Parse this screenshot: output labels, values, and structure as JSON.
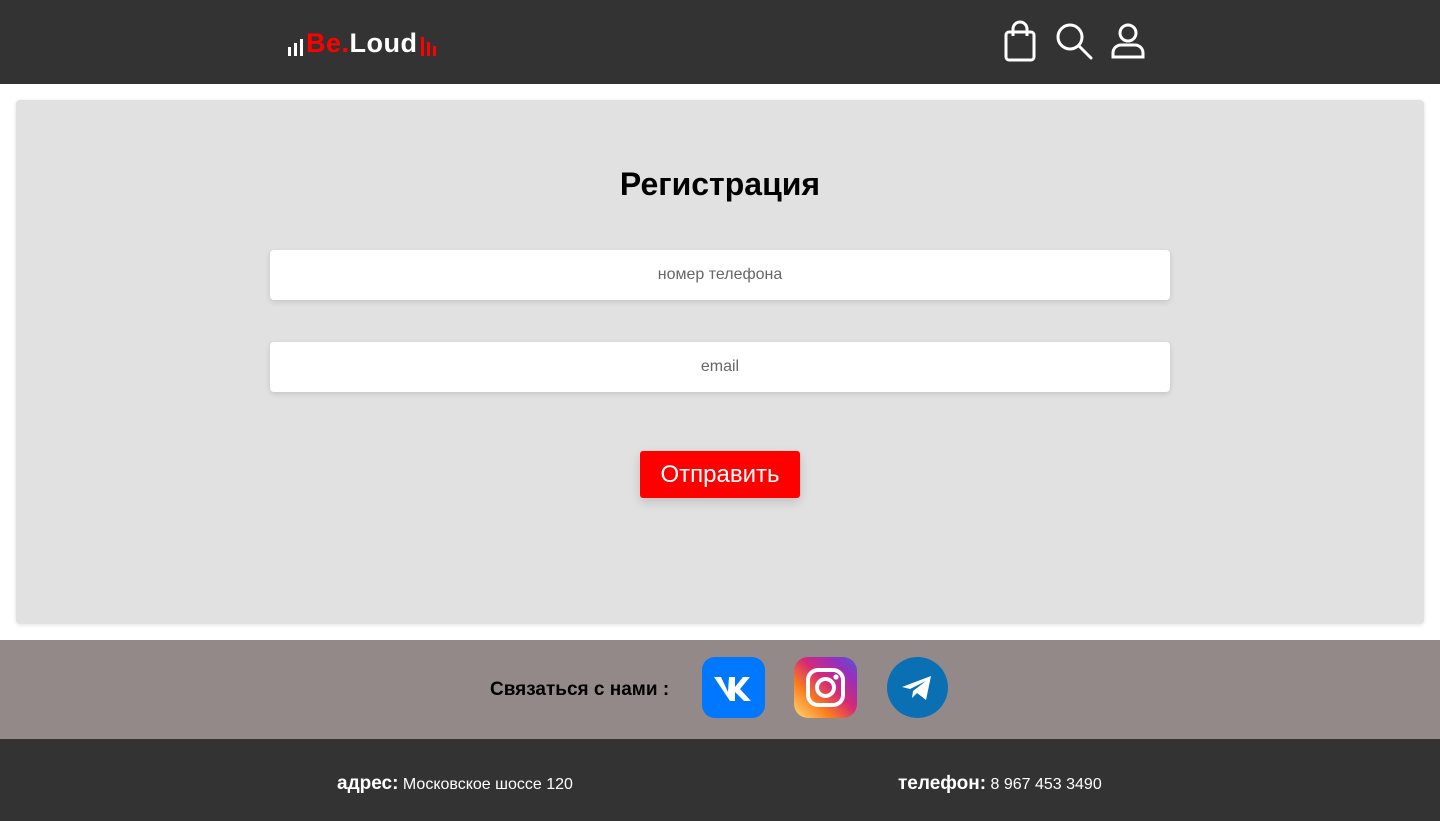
{
  "header": {
    "logo": {
      "part1": "Be.",
      "part2": "Loud"
    },
    "icons": [
      "cart-icon",
      "search-icon",
      "user-icon"
    ]
  },
  "form": {
    "title": "Регистрация",
    "phone_placeholder": "номер телефона",
    "email_placeholder": "email",
    "submit_label": "Отправить"
  },
  "contact": {
    "label": "Связаться с нами :",
    "socials": [
      {
        "name": "vk-icon",
        "color": "#0077ff"
      },
      {
        "name": "instagram-icon",
        "color": "#d62976"
      },
      {
        "name": "telegram-icon",
        "color": "#0a6fb3"
      }
    ]
  },
  "footer": {
    "address_label": "адрес:",
    "address_value": "Московское шоссе 120",
    "phone_label": "телефон:",
    "phone_value": "8 967 453 3490"
  },
  "colors": {
    "header_bg": "#333333",
    "accent": "#ff0000",
    "card_bg": "#e1e1e1",
    "contact_bg": "#928988"
  }
}
